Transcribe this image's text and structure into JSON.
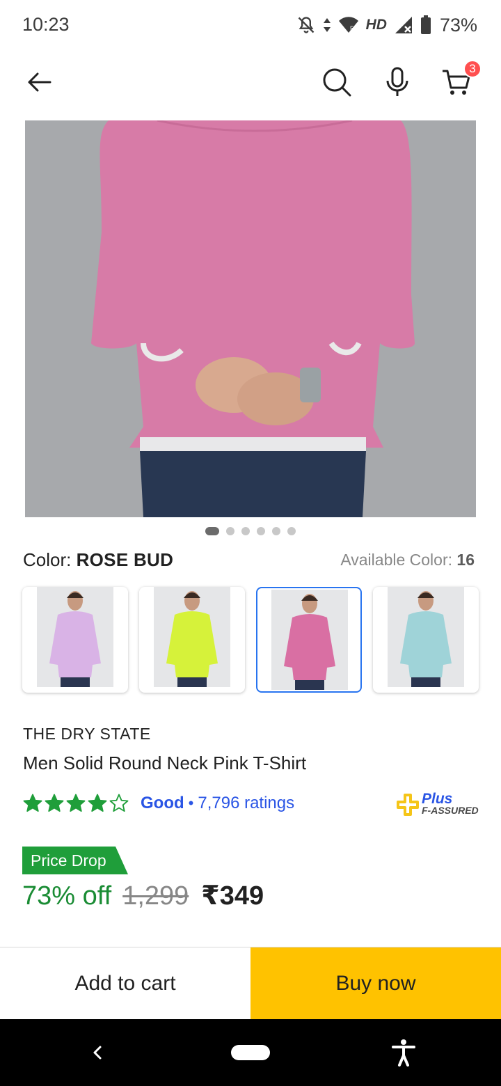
{
  "status_bar": {
    "time": "10:23",
    "network": "HD",
    "battery": "73%",
    "icons": [
      "bell-off-icon",
      "data-arrows-icon",
      "wifi-icon",
      "signal-icon",
      "battery-icon"
    ]
  },
  "app_bar": {
    "icons": [
      "back-arrow-icon",
      "search-icon",
      "mic-icon",
      "cart-icon"
    ],
    "cart_count": "3"
  },
  "gallery": {
    "image_count": 6,
    "active_index": 0
  },
  "color_selector": {
    "label": "Color: ",
    "selected": "ROSE BUD",
    "available_label": "Available Color: ",
    "available_count": "16",
    "swatches": [
      {
        "color": "#d9b3e6",
        "selected": false
      },
      {
        "color": "#d6f23a",
        "selected": false
      },
      {
        "color": "#d96fa3",
        "selected": true
      },
      {
        "color": "#9fd3d8",
        "selected": false
      }
    ]
  },
  "product": {
    "brand": "THE DRY STATE",
    "title": "Men Solid Round Neck Pink T-Shirt",
    "rating_stars": 4,
    "rating_max": 5,
    "rating_word": "Good",
    "rating_separator": "•",
    "ratings_count": "7,796 ratings",
    "assured_line1": "Plus",
    "assured_line2": "F-ASSURED"
  },
  "pricing": {
    "badge": "Price Drop",
    "discount": "73% off",
    "mrp": "1,299",
    "price": "₹349"
  },
  "actions": {
    "add_to_cart": "Add to cart",
    "buy_now": "Buy now"
  },
  "colors": {
    "accent_blue": "#2874f0",
    "rating_green": "#1f9e3a",
    "buy_yellow": "#ffc200",
    "badge_red": "#ff4f4f"
  }
}
